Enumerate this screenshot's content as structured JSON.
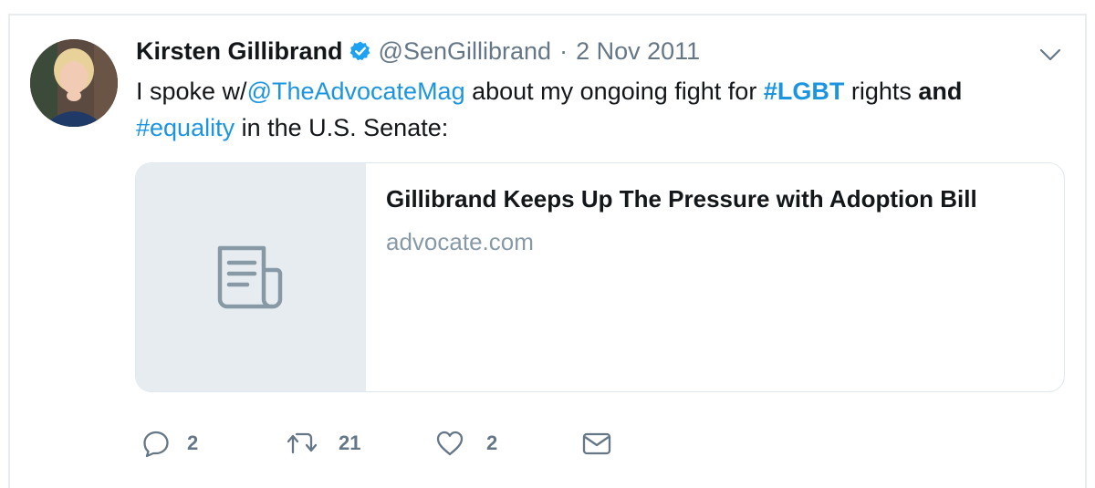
{
  "tweet": {
    "author_name": "Kirsten Gillibrand",
    "handle": "@SenGillibrand",
    "separator": "·",
    "date": "2 Nov 2011",
    "icons": {
      "avatar": "avatar",
      "verified": "verified-badge-icon",
      "caret": "chevron-down-icon"
    },
    "text": {
      "p1": "I spoke w/",
      "mention": "@TheAdvocateMag",
      "p2": " about my ongoing fight for ",
      "hashtag1": "#LGBT",
      "p3": " rights ",
      "bold": "and",
      "p4": " ",
      "hashtag2": "#equality",
      "p5": " in the U.S. Senate:"
    },
    "card": {
      "title": "Gillibrand Keeps Up The Pressure with Adoption Bill",
      "domain": "advocate.com",
      "icon": "document-icon"
    },
    "actions": {
      "reply": {
        "icon": "reply-icon",
        "count": "2"
      },
      "retweet": {
        "icon": "retweet-icon",
        "count": "21"
      },
      "like": {
        "icon": "heart-icon",
        "count": "2"
      },
      "dm": {
        "icon": "envelope-icon"
      }
    },
    "colors": {
      "link": "#1b95e0",
      "secondary_text": "#657786",
      "card_domain": "#8899a6",
      "card_thumb_bg": "#e6ecf0",
      "verified": "#1da1f2"
    }
  }
}
